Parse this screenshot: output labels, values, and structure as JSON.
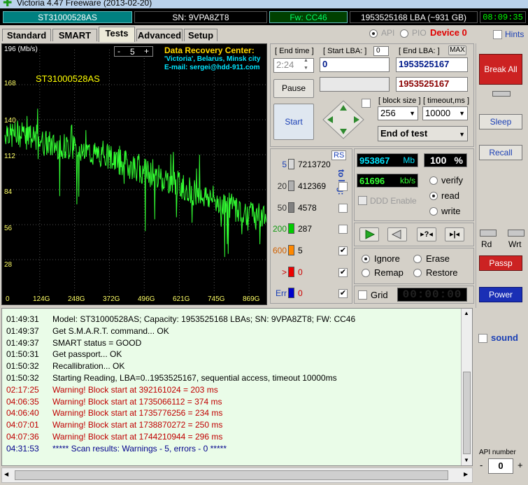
{
  "window": {
    "title": "Victoria 4.47 Freeware (2013-02-20)"
  },
  "info": {
    "model": "ST31000528AS",
    "serial": "SN: 9VPA8ZT8",
    "firmware": "Fw: CC46",
    "lba": "1953525168 LBA (~931 GB)",
    "clock": "08:09:35"
  },
  "tabs": [
    {
      "label": "Standard"
    },
    {
      "label": "SMART"
    },
    {
      "label": "Tests"
    },
    {
      "label": "Advanced"
    },
    {
      "label": "Setup"
    }
  ],
  "mode": {
    "api": "API",
    "pio": "PIO",
    "device": "Device 0",
    "hints": "Hints"
  },
  "graph": {
    "unit": "196 (Mb/s)",
    "model": "ST31000528AS",
    "spin_value": "5",
    "spin_minus": "-",
    "spin_plus": "+",
    "drc_title": "Data Recovery Center:",
    "drc_line1": "'Victoria', Belarus, Minsk city",
    "drc_line2": "E-mail: sergei@hdd-911.com",
    "y_ticks": [
      "168",
      "140",
      "112",
      "84",
      "56",
      "28"
    ],
    "x_ticks": [
      "0",
      "124G",
      "248G",
      "372G",
      "496G",
      "621G",
      "745G",
      "869G"
    ],
    "line_color": "#33ff33"
  },
  "chart_data": {
    "type": "line",
    "ylim": [
      0,
      196
    ],
    "xlim": [
      0,
      931
    ],
    "series": [
      {
        "values": [
          [
            0,
            128
          ],
          [
            10,
            133
          ],
          [
            20,
            126
          ],
          [
            30,
            129
          ],
          [
            40,
            127
          ],
          [
            50,
            131
          ],
          [
            60,
            125
          ],
          [
            70,
            128
          ],
          [
            80,
            124
          ],
          [
            90,
            127
          ],
          [
            100,
            123
          ],
          [
            110,
            126
          ],
          [
            124,
            122
          ],
          [
            150,
            121
          ],
          [
            175,
            119
          ],
          [
            200,
            120
          ],
          [
            225,
            117
          ],
          [
            248,
            118
          ],
          [
            275,
            115
          ],
          [
            300,
            114
          ],
          [
            325,
            112
          ],
          [
            350,
            111
          ],
          [
            372,
            110
          ],
          [
            400,
            107
          ],
          [
            425,
            105
          ],
          [
            450,
            103
          ],
          [
            475,
            101
          ],
          [
            496,
            99
          ],
          [
            525,
            96
          ],
          [
            550,
            94
          ],
          [
            575,
            92
          ],
          [
            600,
            90
          ],
          [
            621,
            88
          ],
          [
            650,
            85
          ],
          [
            675,
            82
          ],
          [
            700,
            80
          ],
          [
            725,
            78
          ],
          [
            745,
            76
          ],
          [
            775,
            73
          ],
          [
            800,
            71
          ],
          [
            825,
            69
          ],
          [
            850,
            67
          ],
          [
            869,
            65
          ],
          [
            890,
            63
          ],
          [
            910,
            62
          ],
          [
            931,
            61
          ]
        ]
      }
    ]
  },
  "controls": {
    "end_time_label": "[ End time ]",
    "end_time_value": "2:24",
    "start_lba_label": "[ Start LBA: ]",
    "start_lba_small": "0",
    "start_lba_value": "0",
    "end_lba_label": "[ End LBA: ]",
    "end_lba_max": "MAX",
    "end_lba_value": "1953525167",
    "end_lba_value2": "1953525167",
    "pause": "Pause",
    "start": "Start",
    "block_size_label": "[ block size ]",
    "block_size_value": "256",
    "timeout_label": "[ timeout,ms ]",
    "timeout_value": "10000",
    "end_of_test": "End of test"
  },
  "blocks": {
    "rs": "RS",
    "to_log": "to log:",
    "rows": [
      {
        "label": "5",
        "count": "7213720",
        "color": "#d8d8d8",
        "checked": ""
      },
      {
        "label": "20",
        "count": "412369",
        "color": "#b0b0b0",
        "checked": ""
      },
      {
        "label": "50",
        "count": "4578",
        "color": "#808080",
        "checked": ""
      },
      {
        "label": "200",
        "count": "287",
        "color": "#00cc00",
        "checked": ""
      },
      {
        "label": "600",
        "count": "5",
        "color": "#ff8800",
        "checked": "✔"
      },
      {
        "label": ">",
        "count": "0",
        "color": "#ee0000",
        "checked": "✔"
      },
      {
        "label": "Err",
        "count": "0",
        "color": "#0000cc",
        "checked": "✔"
      }
    ]
  },
  "stats": {
    "mb_value": "953867",
    "mb_unit": "Mb",
    "percent_value": "100",
    "percent_unit": "%",
    "speed_value": "61696",
    "speed_unit": "kb/s",
    "ddd_enable": "DDD Enable",
    "verify": "verify",
    "read": "read",
    "write": "write",
    "ignore": "Ignore",
    "erase": "Erase",
    "remap": "Remap",
    "restore": "Restore",
    "grid": "Grid",
    "timer": "00:00:00"
  },
  "side": {
    "break_all": "Break All",
    "sleep": "Sleep",
    "recall": "Recall",
    "rd": "Rd",
    "wrt": "Wrt",
    "passp": "Passp",
    "power": "Power",
    "sound": "sound",
    "api_number_label": "API number",
    "api_number_value": "0",
    "api_minus": "-",
    "api_plus": "+"
  },
  "log": [
    {
      "time": "01:49:31",
      "text": "Model: ST31000528AS; Capacity: 1953525168 LBAs; SN: 9VPA8ZT8; FW: CC46",
      "kind": "info"
    },
    {
      "time": "01:49:37",
      "text": "Get S.M.A.R.T. command... OK",
      "kind": "info"
    },
    {
      "time": "01:49:37",
      "text": "SMART status = GOOD",
      "kind": "info"
    },
    {
      "time": "01:50:31",
      "text": "Get passport... OK",
      "kind": "info"
    },
    {
      "time": "01:50:32",
      "text": "Recallibration... OK",
      "kind": "info"
    },
    {
      "time": "01:50:32",
      "text": "Starting Reading, LBA=0..1953525167, sequential access, timeout 10000ms",
      "kind": "info"
    },
    {
      "time": "02:17:25",
      "text": "Warning! Block start at 392161024 = 203 ms",
      "kind": "warn"
    },
    {
      "time": "04:06:35",
      "text": "Warning! Block start at 1735066112 = 374 ms",
      "kind": "warn"
    },
    {
      "time": "04:06:40",
      "text": "Warning! Block start at 1735776256 = 234 ms",
      "kind": "warn"
    },
    {
      "time": "04:07:01",
      "text": "Warning! Block start at 1738870272 = 250 ms",
      "kind": "warn"
    },
    {
      "time": "04:07:36",
      "text": "Warning! Block start at 1744210944 = 296 ms",
      "kind": "warn"
    },
    {
      "time": "04:31:53",
      "text": "***** Scan results: Warnings - 5, errors - 0 *****",
      "kind": "result"
    }
  ]
}
